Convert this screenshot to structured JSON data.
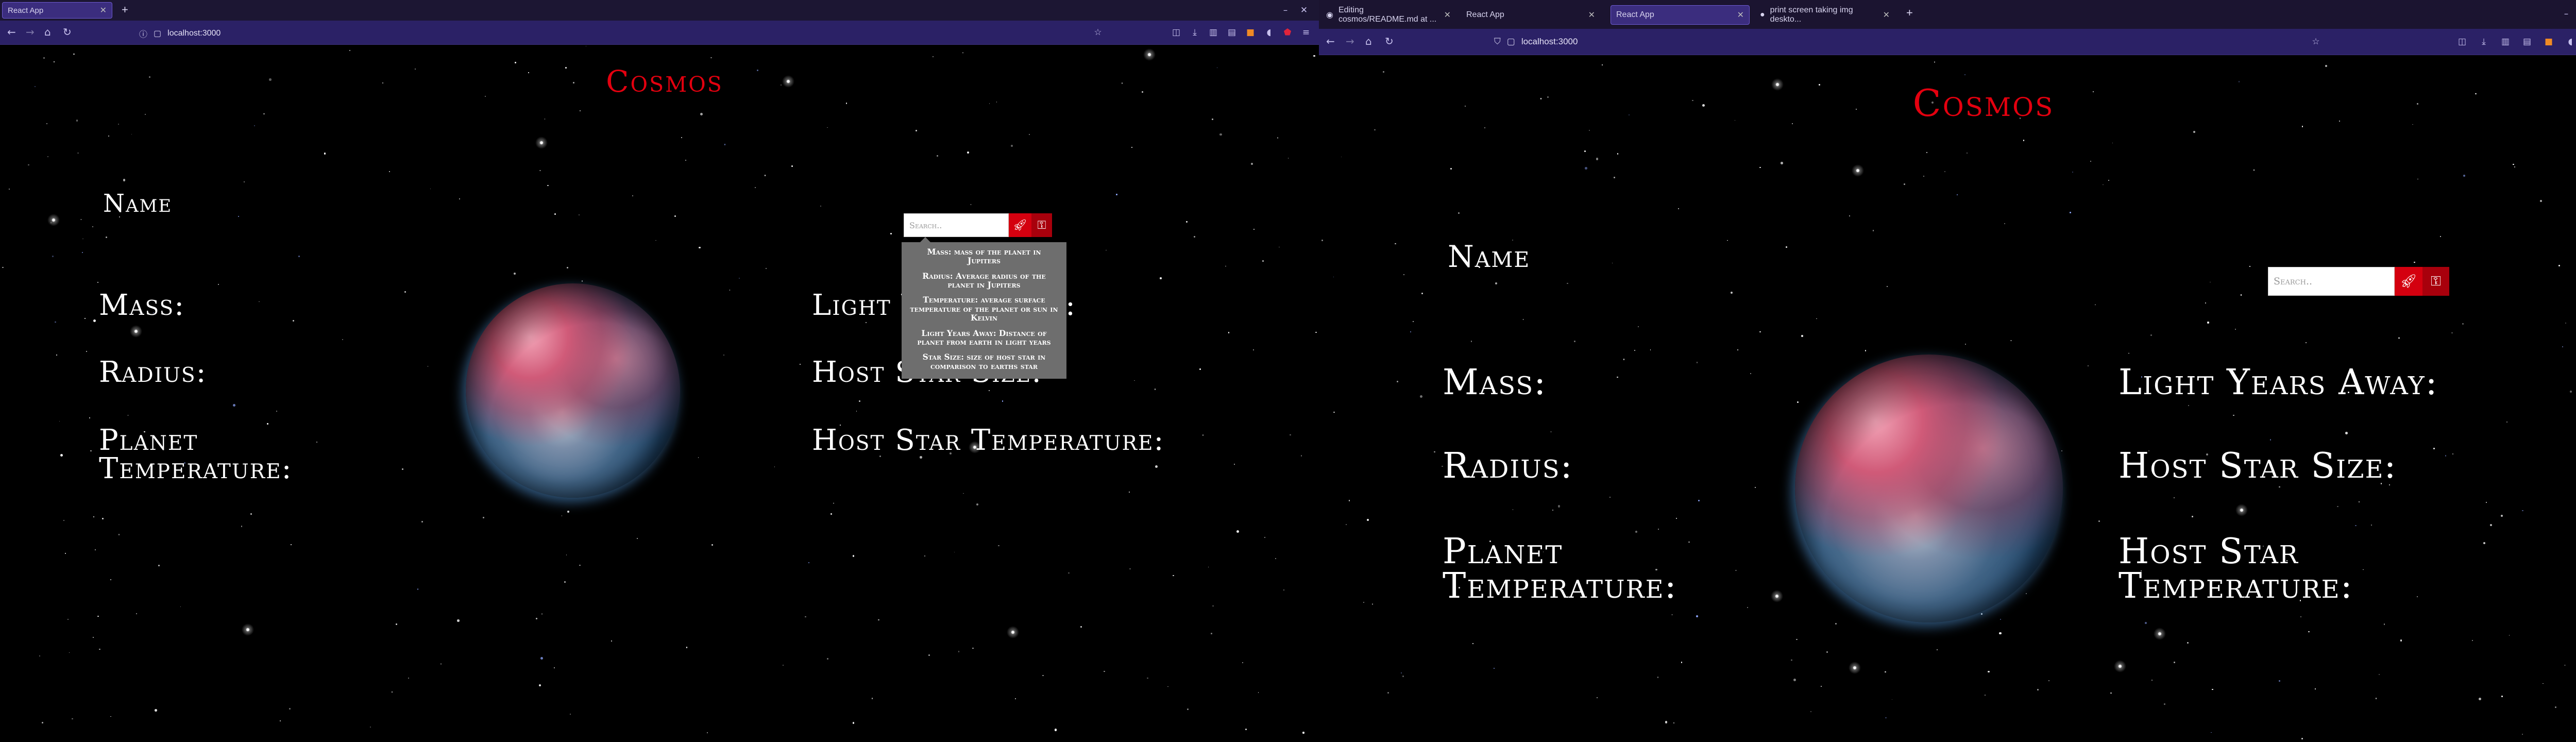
{
  "left_window": {
    "tabs": [
      {
        "title": "React App",
        "active": true
      }
    ],
    "url": "localhost:3000",
    "app": {
      "title": "Cosmos",
      "name_label": "Name",
      "mass_label": "Mass:",
      "radius_label": "Radius:",
      "planet_temp_label_line1": "Planet",
      "planet_temp_label_line2": "Temperature:",
      "light_years_label": "Light Years Away:",
      "host_star_size_label": "Host Star Size:",
      "host_star_temp_label": "Host Star Temperature:",
      "search_placeholder": "Search..",
      "tooltip": [
        "Mass: mass of the planet in Jupiters",
        "Radius: Average radius of the planet in Jupiters",
        "Temperature: average surface temperature of the planet or sun in Kelvin",
        "Light Years Away: Distance of planet from earth in light years",
        "Star Size: size of host star in comparison to earths star"
      ]
    }
  },
  "right_window": {
    "tabs": [
      {
        "title": "Editing cosmos/README.md at ...",
        "active": false
      },
      {
        "title": "React App",
        "active": false
      },
      {
        "title": "React App",
        "active": true
      },
      {
        "title": "print screen taking img deskto...",
        "active": false
      }
    ],
    "url": "localhost:3000",
    "app": {
      "title": "Cosmos",
      "name_label": "Name",
      "mass_label": "Mass:",
      "radius_label": "Radius:",
      "planet_temp_label_line1": "Planet",
      "planet_temp_label_line2": "Temperature:",
      "light_years_label": "Light Years Away:",
      "host_star_size_label": "Host Star Size:",
      "host_star_temp_label_line1": "Host Star",
      "host_star_temp_label_line2": "Temperature:",
      "search_placeholder": "Search.."
    }
  },
  "icons": {
    "back": "back-arrow-icon",
    "forward": "forward-arrow-icon",
    "reload": "reload-icon",
    "home": "home-icon",
    "info": "info-icon",
    "bookmark": "star-icon",
    "rocket_search_button": "rocket-icon",
    "key_button": "key-icon"
  },
  "colors": {
    "title_red": "#e3000f",
    "button_red": "#d4000f",
    "chrome_purple": "#2b2166",
    "tooltip_gray": "#6e6e6e"
  }
}
